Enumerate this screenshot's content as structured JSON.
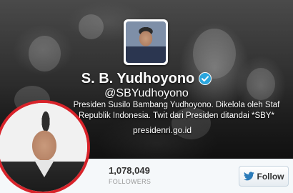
{
  "profile": {
    "name": "S. B. Yudhoyono",
    "handle": "@SBYudhoyono",
    "bio_lines": [
      "Presiden Susilo Bambang Yudhoyono. Dikelola oleh Staf",
      "Republik Indonesia. Twit dari Presiden ditandai *SBY*"
    ],
    "website": "presidenri.go.id",
    "verified_icon": "verified-badge-icon",
    "avatar_icon": "profile-avatar"
  },
  "stats": {
    "followers_count": "1,078,049",
    "followers_label": "FOLLOWERS"
  },
  "actions": {
    "follow_label": "Follow",
    "follow_icon": "twitter-bird-icon"
  },
  "colors": {
    "verified_blue": "#2ba6de",
    "twitter_blue": "#2b7bb9",
    "overlay_border_red": "#d8232a",
    "stats_bg": "#f5f8fa"
  }
}
